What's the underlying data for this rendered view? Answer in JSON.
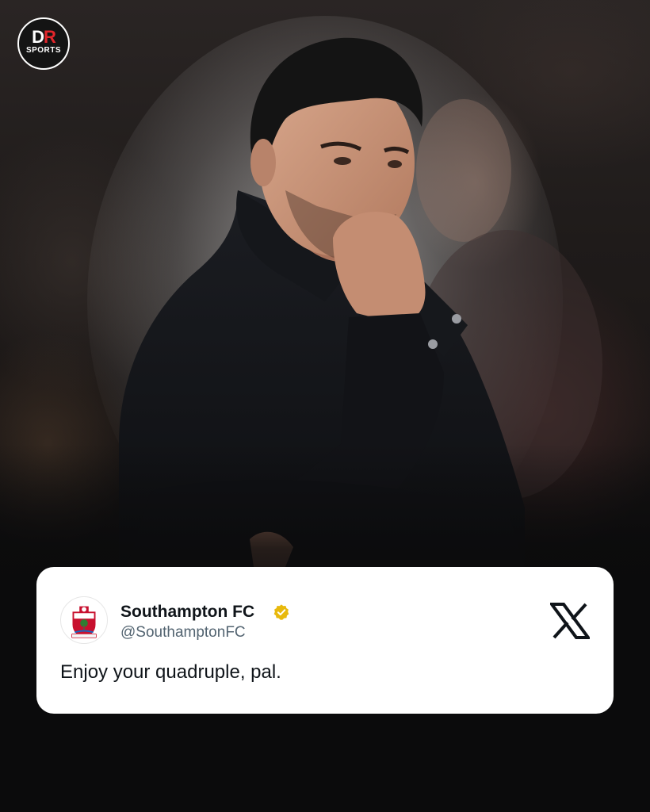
{
  "brand": {
    "logo_mark_d": "D",
    "logo_mark_r": "R",
    "logo_sub": "SPORTS",
    "accent_color": "#e3262b"
  },
  "photo": {
    "icon": "manager-photo"
  },
  "tweet": {
    "display_name": "Southampton FC",
    "handle": "@SouthamptonFC",
    "text": "Enjoy your quadruple, pal.",
    "verified_color": "#e8b90c",
    "avatar_icon": "club-crest-icon",
    "platform_icon": "x-logo-icon"
  }
}
